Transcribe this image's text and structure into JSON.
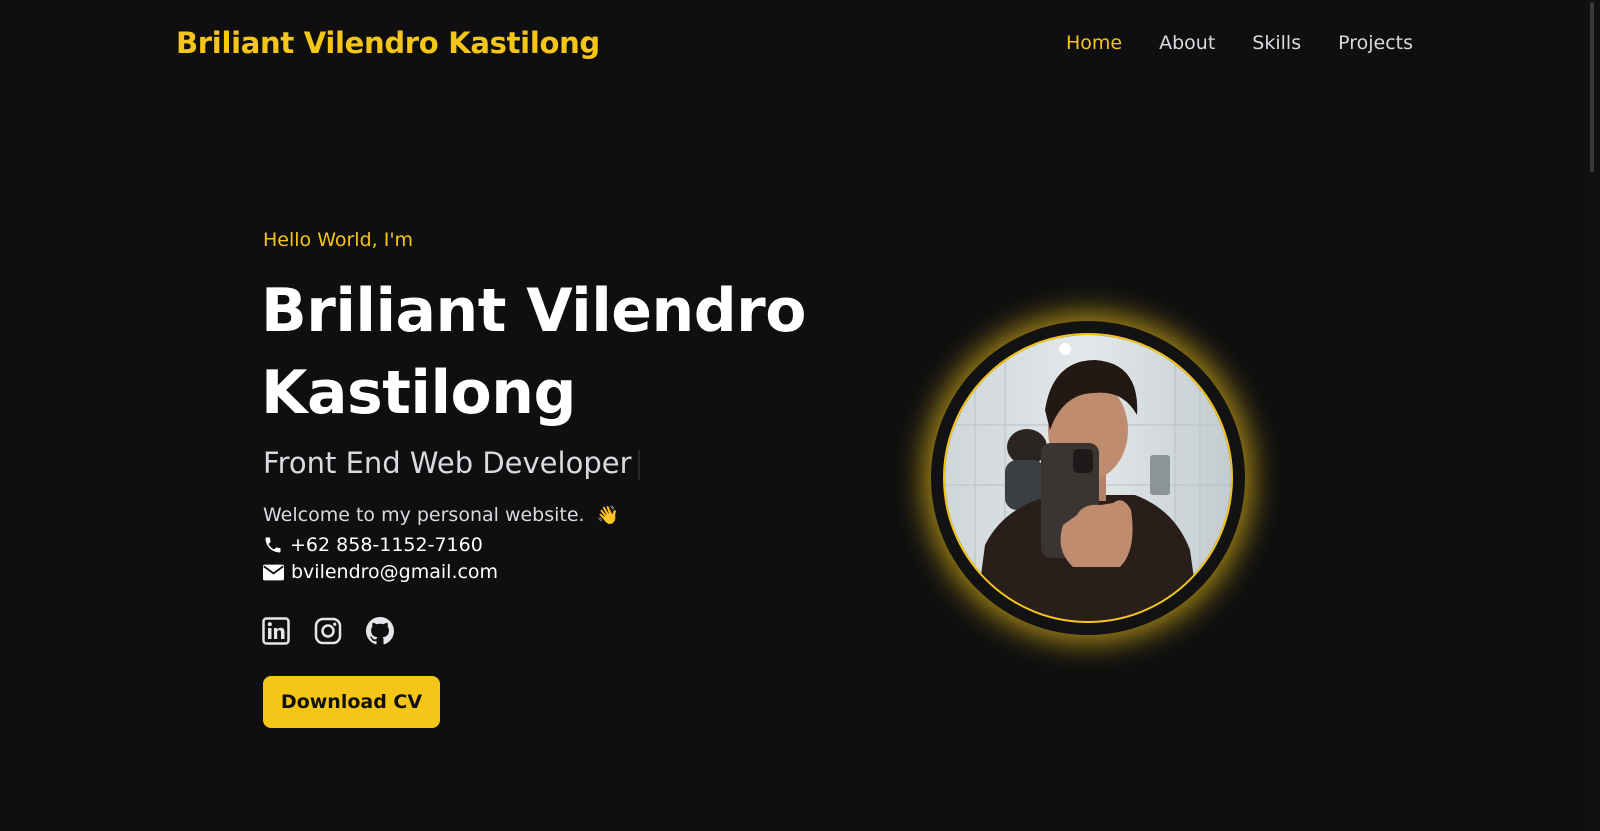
{
  "header": {
    "logo": "Briliant Vilendro Kastilong",
    "nav": [
      {
        "label": "Home",
        "active": true
      },
      {
        "label": "About",
        "active": false
      },
      {
        "label": "Skills",
        "active": false
      },
      {
        "label": "Projects",
        "active": false
      }
    ]
  },
  "hero": {
    "greeting": "Hello World, I'm",
    "name": "Briliant Vilendro Kastilong",
    "role": "Front End Web Developer",
    "welcome": "Welcome to my personal website.",
    "phone": "+62 858-1152-7160",
    "email": "bvilendro@gmail.com",
    "socials": [
      {
        "icon": "linkedin-icon"
      },
      {
        "icon": "instagram-icon"
      },
      {
        "icon": "github-icon"
      }
    ],
    "cv_button": "Download CV"
  },
  "colors": {
    "background": "#0f0f10",
    "accent": "#f5c518",
    "text": "#ffffff",
    "muted": "#d9d9e0"
  }
}
